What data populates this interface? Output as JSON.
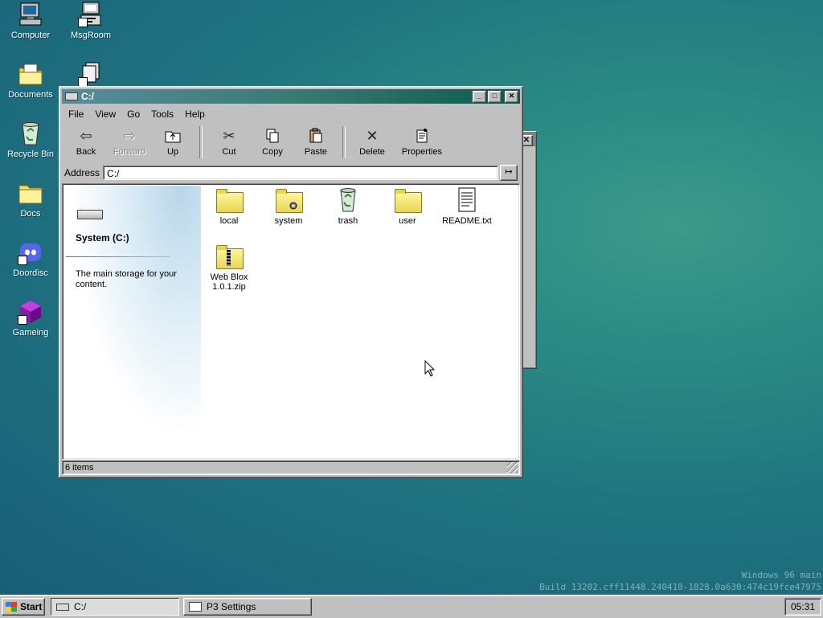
{
  "desktop": {
    "icons": [
      {
        "label": "Computer"
      },
      {
        "label": "MsgRoom"
      },
      {
        "label": "Documents"
      },
      {
        "label": "Recycle Bin"
      },
      {
        "label": "Docs"
      },
      {
        "label": "Doordisc"
      },
      {
        "label": "Gameing"
      }
    ],
    "watermark": {
      "line1": "Windows 96 main",
      "line2": "Build 13202.cff11448.240410-1828.0a630:474c19fce47975"
    }
  },
  "explorer": {
    "title": "C:/",
    "menu": [
      "File",
      "View",
      "Go",
      "Tools",
      "Help"
    ],
    "toolbar": {
      "back": "Back",
      "forward": "Forward",
      "up": "Up",
      "cut": "Cut",
      "copy": "Copy",
      "paste": "Paste",
      "delete": "Delete",
      "properties": "Properties"
    },
    "address": {
      "label": "Address",
      "value": "C:/"
    },
    "sidebar": {
      "title": "System (C:)",
      "description": "The main storage for your content."
    },
    "files": [
      {
        "name": "local",
        "icon": "folder-icon"
      },
      {
        "name": "system",
        "icon": "system-folder-icon"
      },
      {
        "name": "trash",
        "icon": "recycle-bin-icon"
      },
      {
        "name": "user",
        "icon": "folder-icon"
      },
      {
        "name": "README.txt",
        "icon": "text-file-icon"
      },
      {
        "name": "Web Blox 1.0.1.zip",
        "icon": "zip-folder-icon"
      }
    ],
    "status": "6 items"
  },
  "taskbar": {
    "start": "Start",
    "tasks": [
      "C:/",
      "P3 Settings"
    ],
    "clock": "05:31"
  },
  "colors": {
    "desktop": "#1f7480",
    "titlebar_active": "#3b7a74",
    "face": "#c0c0c0"
  }
}
